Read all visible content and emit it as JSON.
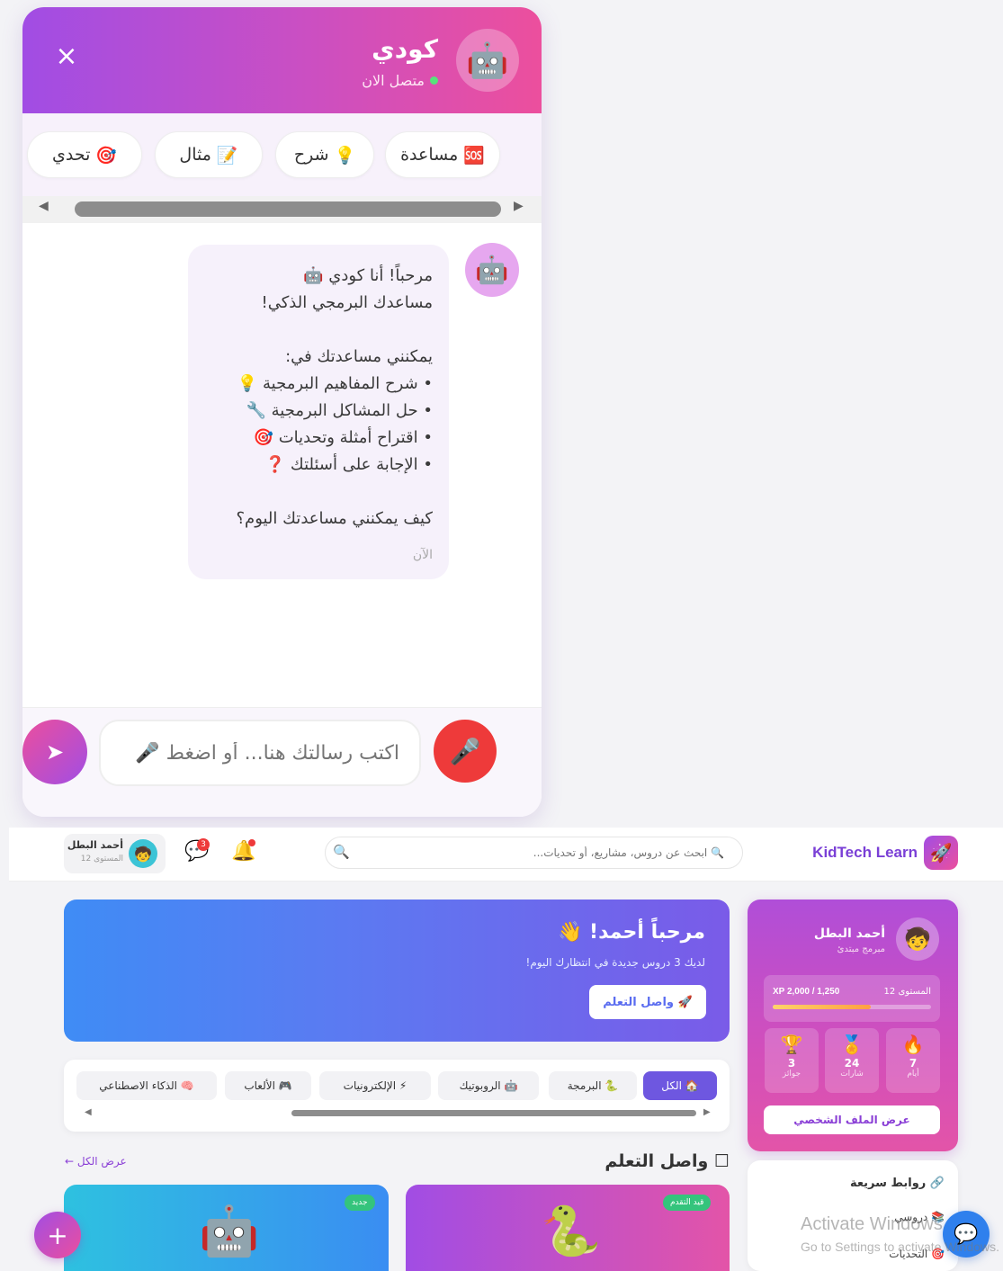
{
  "chat": {
    "bot_name": "كودي",
    "status": "متصل الان",
    "bot_avatar_emoji": "🤖",
    "quick_actions": [
      {
        "icon": "🆘",
        "label": "مساعدة"
      },
      {
        "icon": "💡",
        "label": "شرح"
      },
      {
        "icon": "📝",
        "label": "مثال"
      },
      {
        "icon": "🎯",
        "label": "تحدي"
      }
    ],
    "message": {
      "line1": "مرحباً! أنا كودي 🤖",
      "line2": "مساعدك البرمجي الذكي!",
      "line3": "يمكنني مساعدتك في:",
      "bullet1": "• شرح المفاهيم البرمجية 💡",
      "bullet2": "• حل المشاكل البرمجية 🔧",
      "bullet3": "• اقتراح أمثلة وتحديات 🎯",
      "bullet4": "• الإجابة على أسئلتك ❓",
      "question": "كيف يمكنني مساعدتك اليوم؟",
      "time": "الآن"
    },
    "input_placeholder": "اكتب رسالتك هنا... أو اضغط 🎤"
  },
  "topbar": {
    "brand": "KidTech Learn",
    "search_placeholder": "🔍 ابحث عن دروس، مشاريع، أو تحديات...",
    "messages_badge": "3",
    "user_name": "أحمد البطل",
    "user_level": "المستوى 12"
  },
  "profile": {
    "name": "أحمد البطل",
    "role": "مبرمج مبتدئ",
    "level": "المستوى 12",
    "xp": "XP 2,000 / 1,250",
    "xp_progress": 0.62,
    "stats": [
      {
        "icon": "🏆",
        "value": "3",
        "label": "جوائز"
      },
      {
        "icon": "🏅",
        "value": "24",
        "label": "شارات"
      },
      {
        "icon": "🔥",
        "value": "7",
        "label": "أيام"
      }
    ],
    "view_profile": "عرض الملف الشخصي"
  },
  "quick_links": {
    "title": "🔗 روابط سريعة",
    "items": [
      "📚 دروسي",
      "🎯 التحديات"
    ]
  },
  "welcome": {
    "title": "مرحباً أحمد! 👋",
    "subtitle": "لديك 3 دروس جديدة في انتظارك اليوم!",
    "cta": "🚀 واصل التعلم"
  },
  "categories": [
    {
      "label": "🏠 الكل",
      "active": true
    },
    {
      "label": "🐍 البرمجة",
      "active": false
    },
    {
      "label": "🤖 الروبوتيك",
      "active": false
    },
    {
      "label": "⚡ الإلكترونيات",
      "active": false
    },
    {
      "label": "🎮 الألعاب",
      "active": false
    },
    {
      "label": "🧠 الذكاء الاصطناعي",
      "active": false
    }
  ],
  "continue": {
    "title": "☐ واصل التعلم",
    "see_all": "عرض الكل ←"
  },
  "courses": [
    {
      "badge": "قيد التقدم",
      "icon": "🐍",
      "badge_color": "#34c47c"
    },
    {
      "badge": "جديد",
      "icon": "🤖",
      "badge_color": "#34c47c"
    }
  ],
  "watermark": {
    "line1": "Activate Windows",
    "line2": "Go to Settings to activate Windows."
  }
}
